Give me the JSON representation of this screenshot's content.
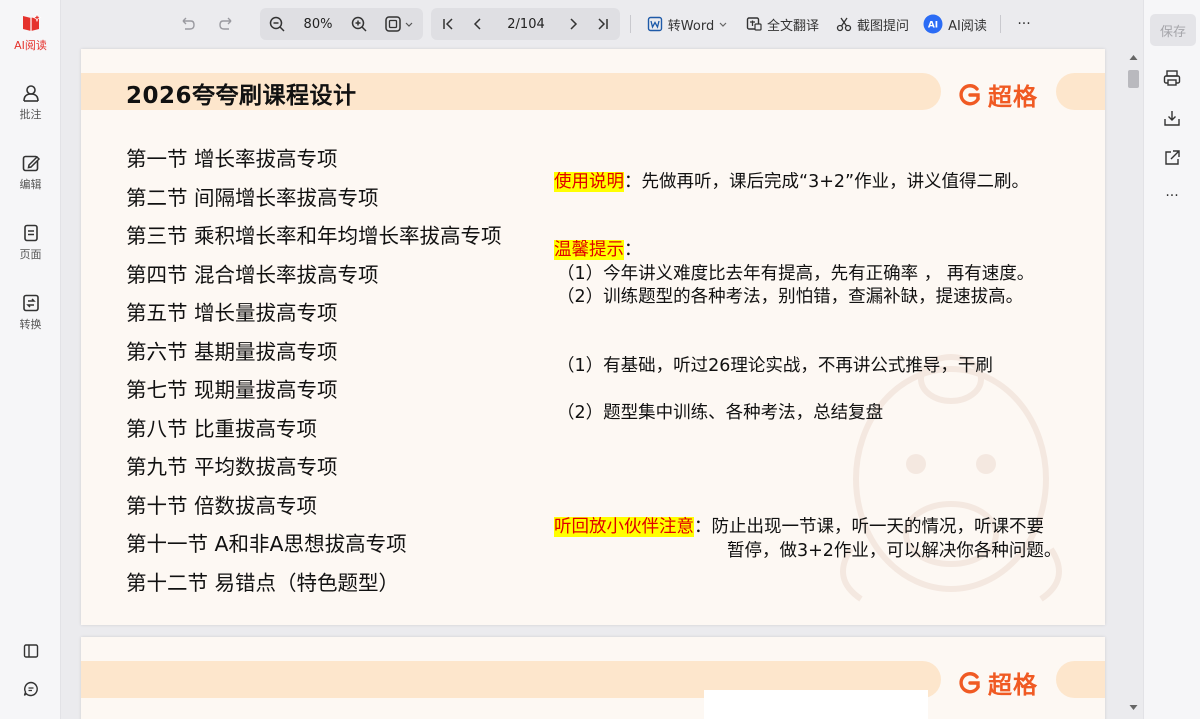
{
  "left_sidebar": {
    "items": [
      {
        "label": "AI阅读",
        "icon": "ai-read-icon"
      },
      {
        "label": "批注",
        "icon": "annotate-icon"
      },
      {
        "label": "编辑",
        "icon": "edit-icon"
      },
      {
        "label": "页面",
        "icon": "page-icon"
      },
      {
        "label": "转换",
        "icon": "convert-icon"
      }
    ],
    "bottom_icons": [
      "sidebar-toggle-icon",
      "feedback-icon"
    ]
  },
  "toolbar": {
    "zoom": "80%",
    "page_indicator": "2/104",
    "to_word": "转Word",
    "translate": "全文翻译",
    "screenshot_ask": "截图提问",
    "ai_read": "AI阅读",
    "more": "···"
  },
  "right_sidebar": {
    "save_label": "保存",
    "icons": [
      "print-icon",
      "download-icon",
      "share-icon",
      "more-icon"
    ],
    "more": "···"
  },
  "document": {
    "title": "2026夸夸刷课程设计",
    "brand": "超格",
    "lessons": [
      "第一节  增长率拔高专项",
      "第二节  间隔增长率拔高专项",
      "第三节  乘积增长率和年均增长率拔高专项",
      "第四节  混合增长率拔高专项",
      "第五节  增长量拔高专项",
      "第六节  基期量拔高专项",
      "第七节  现期量拔高专项",
      "第八节  比重拔高专项",
      "第九节  平均数拔高专项",
      "第十节  倍数拔高专项",
      "第十一节  A和非A思想拔高专项",
      "第十二节 易错点（特色题型）"
    ],
    "usage_label": "使用说明",
    "usage_text": "：先做再听，课后完成“3+2”作业，讲义值得二刷。",
    "tips_label": "温馨提示",
    "tips_colon": "：",
    "tips": [
      "（1）今年讲义难度比去年有提高，先有正确率 ， 再有速度。",
      "（2）训练题型的各种考法，别怕错，查漏补缺，提速拔高。"
    ],
    "points": [
      "（1）有基础，听过26理论实战，不再讲公式推导，干刷",
      "（2）题型集中训练、各种考法，总结复盘"
    ],
    "replay_label": "听回放小伙伴注意",
    "replay_colon": "：",
    "replay_line1": "防止出现一节课，听一天的情况，听课不要",
    "replay_line2": "暂停，做3+2作业，可以解决你各种问题。"
  },
  "page2": {
    "brand": "超格"
  },
  "colors": {
    "accent": "#e5322d",
    "brand": "#f05a23",
    "highlight": "#ffff00",
    "band": "#fde6cc"
  }
}
